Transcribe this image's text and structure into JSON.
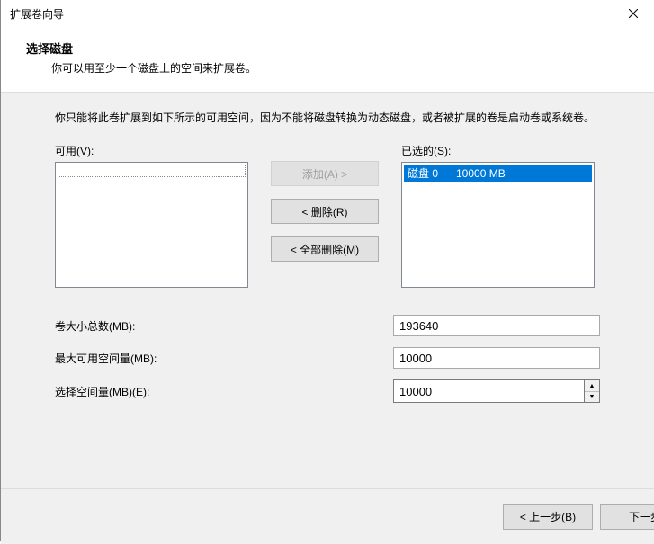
{
  "window": {
    "title": "扩展卷向导"
  },
  "header": {
    "title": "选择磁盘",
    "subtitle": "你可以用至少一个磁盘上的空间来扩展卷。"
  },
  "body": {
    "description": "你只能将此卷扩展到如下所示的可用空间，因为不能将磁盘转换为动态磁盘，或者被扩展的卷是启动卷或系统卷。",
    "available_label": "可用(V):",
    "selected_label": "已选的(S):",
    "available_items": [],
    "selected_items": [
      {
        "text": "磁盘 0      10000 MB",
        "selected": true
      }
    ],
    "buttons": {
      "add": "添加(A) >",
      "remove": "< 删除(R)",
      "remove_all": "< 全部删除(M)"
    },
    "fields": {
      "total_label": "卷大小总数(MB):",
      "total_value": "193640",
      "max_label": "最大可用空间量(MB):",
      "max_value": "10000",
      "select_label": "选择空间量(MB)(E):",
      "select_value": "10000"
    }
  },
  "footer": {
    "back": "< 上一步(B)",
    "next": "下一步"
  }
}
